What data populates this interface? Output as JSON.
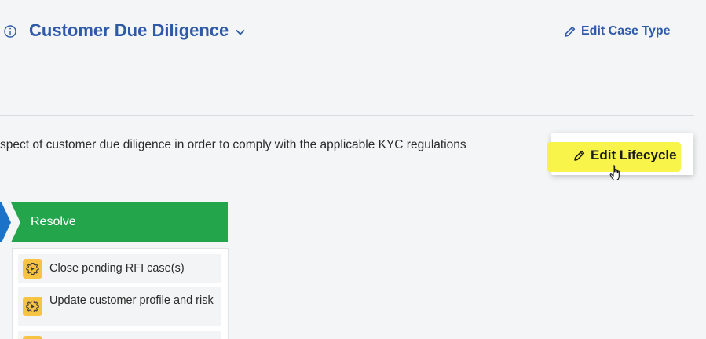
{
  "header": {
    "case_type_title": "Customer Due Diligence",
    "edit_case_type_label": "Edit Case Type"
  },
  "description": "spect of customer due diligence in order to comply with the applicable KYC regulations",
  "lifecycle": {
    "edit_label": "Edit Lifecycle"
  },
  "stages": [
    {
      "label": "Resolve",
      "color": "#23a54b"
    }
  ],
  "steps": [
    {
      "label": "Close pending RFI case(s)",
      "icon": "automation-gear-icon"
    },
    {
      "label": "Update customer profile and risk",
      "icon": "automation-gear-icon"
    },
    {
      "label": "",
      "icon": "automation-gear-icon"
    }
  ],
  "colors": {
    "accent": "#2e5aa8",
    "stage_green": "#23a54b",
    "prev_stage_blue": "#1a73c8",
    "highlight": "#f7f33a",
    "step_icon": "#f6c343"
  }
}
